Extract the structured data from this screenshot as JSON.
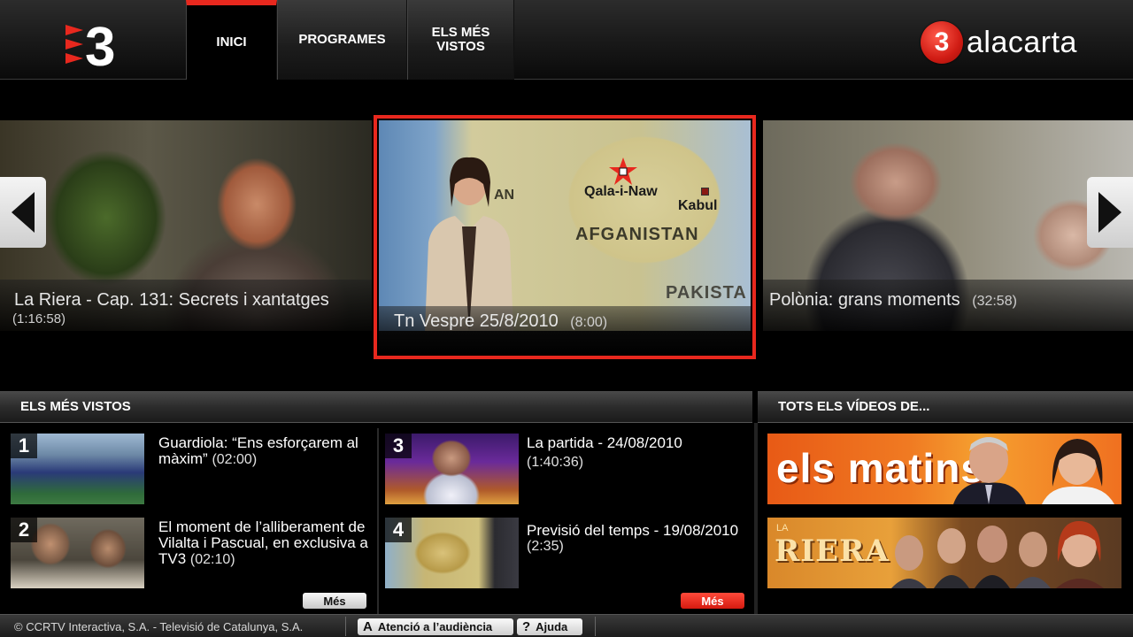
{
  "header": {
    "logo_alt": "3",
    "tabs": [
      {
        "label": "INICI",
        "active": true
      },
      {
        "label": "PROGRAMES",
        "active": false
      },
      {
        "label": "ELS MÉS\nVISTOS",
        "active": false
      }
    ],
    "brand_badge": "3",
    "brand_text": "alacarta"
  },
  "carousel": {
    "slides": [
      {
        "title": "La Riera - Cap. 131: Secrets i xantatges",
        "duration": "(1:16:58)"
      },
      {
        "title": "Tn Vespre 25/8/2010",
        "duration": "(8:00)",
        "selected": true,
        "map_labels": [
          "AN",
          "Qala-i-Naw",
          "Kabul",
          "AFGANISTAN",
          "PAKISTA"
        ]
      },
      {
        "title": "Polònia: grans moments",
        "duration": "(32:58)"
      }
    ],
    "arrow_left_icon": "arrow-left-icon",
    "arrow_right_icon": "arrow-right-icon"
  },
  "most_viewed": {
    "heading": "ELS MÉS VISTOS",
    "items": [
      {
        "rank": "1",
        "title": "Guardiola: “Ens esforçarem al màxim”",
        "duration": "(02:00)"
      },
      {
        "rank": "2",
        "title": "El moment de l’alliberament de Vilalta i Pascual, en exclusiva a TV3",
        "duration": "(02:10)"
      },
      {
        "rank": "3",
        "title": "La partida - 24/08/2010",
        "duration": "(1:40:36)"
      },
      {
        "rank": "4",
        "title": "Previsió del temps - 19/08/2010",
        "duration": "(2:35)"
      }
    ],
    "more_left": "Més",
    "more_right": "Més"
  },
  "all_videos": {
    "heading": "TOTS ELS VÍDEOS DE...",
    "programs": [
      {
        "name": "els matins"
      },
      {
        "name": "RIERA",
        "prefix": "LA"
      }
    ]
  },
  "footer": {
    "copyright": "© CCRTV Interactiva, S.A. - Televisió de Catalunya, S.A.",
    "atencio_icon": "A",
    "atencio_label": "Atenció a l’audiència",
    "ajuda_icon": "?",
    "ajuda_label": "Ajuda"
  },
  "colors": {
    "accent": "#e8281e",
    "background": "#000000"
  }
}
